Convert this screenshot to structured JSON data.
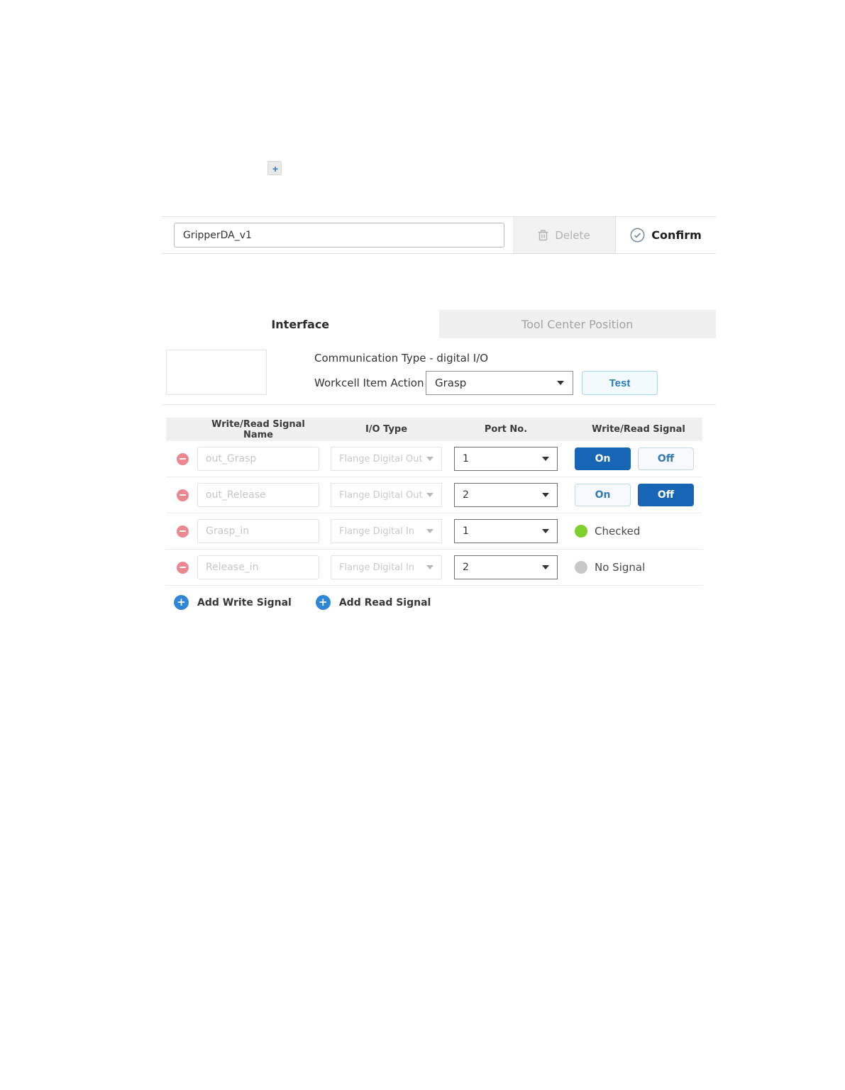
{
  "top": {
    "add_item_label": "+"
  },
  "header": {
    "name_value": "GripperDA_v1",
    "delete_label": "Delete",
    "confirm_label": "Confirm"
  },
  "tabs": [
    {
      "label": "Interface",
      "active": true
    },
    {
      "label": "Tool Center Position",
      "active": false
    }
  ],
  "meta": {
    "communication_type": "Communication Type - digital I/O",
    "workcell_label": "Workcell Item Action",
    "workcell_value": "Grasp",
    "test_label": "Test"
  },
  "table": {
    "headers": [
      "Write/Read Signal Name",
      "I/O Type",
      "Port No.",
      "Write/Read Signal"
    ],
    "rows": [
      {
        "name": "out_Grasp",
        "io_type": "Flange Digital Out",
        "port": "1",
        "kind": "toggle",
        "on_label": "On",
        "off_label": "Off",
        "active": "on"
      },
      {
        "name": "out_Release",
        "io_type": "Flange Digital Out",
        "port": "2",
        "kind": "toggle",
        "on_label": "On",
        "off_label": "Off",
        "active": "off"
      },
      {
        "name": "Grasp_in",
        "io_type": "Flange Digital In",
        "port": "1",
        "kind": "status",
        "status": "Checked",
        "status_color": "#7fd02d"
      },
      {
        "name": "Release_in",
        "io_type": "Flange Digital In",
        "port": "2",
        "kind": "status",
        "status": "No Signal",
        "status_color": "#c8c8c8"
      }
    ]
  },
  "actions": {
    "add_write_label": "Add Write Signal",
    "add_read_label": "Add Read Signal"
  },
  "colors": {
    "primary_blue": "#1765b5",
    "toggle_dim_text": "#3478b8",
    "test_blue": "#2a7cc2",
    "add_circle_blue": "#2f86d6",
    "remove_red": "#ea8790",
    "green_status": "#7fd02d",
    "gray_status": "#c8c8c8"
  }
}
